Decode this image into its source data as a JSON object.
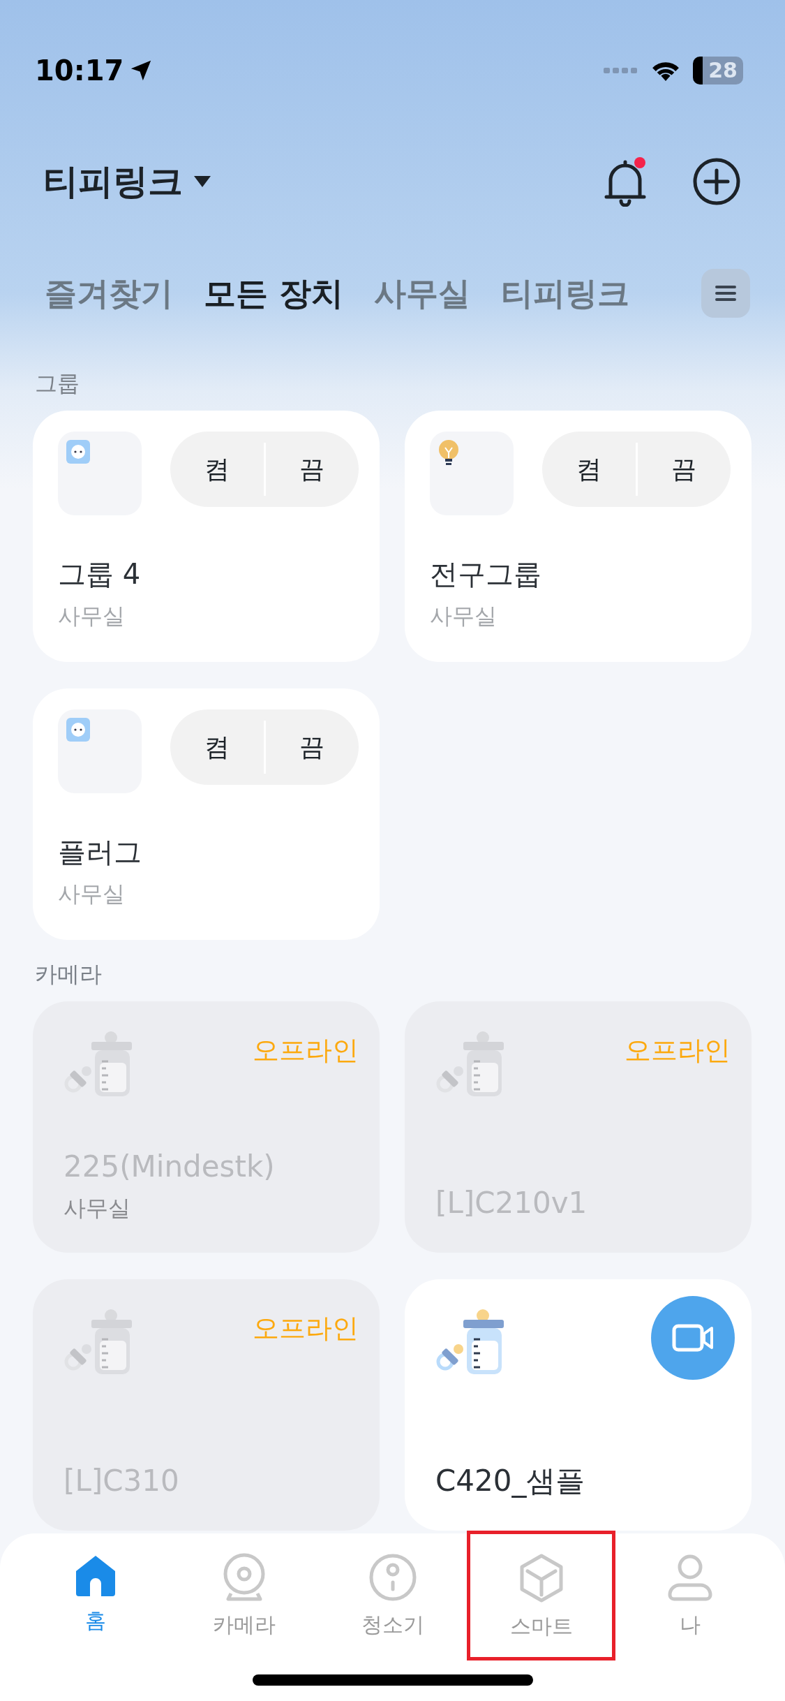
{
  "status_bar": {
    "time": "10:17",
    "battery": "28"
  },
  "header": {
    "title": "티피링크",
    "notification_unread": true
  },
  "tabs": [
    {
      "label": "즐겨찾기",
      "selected": false
    },
    {
      "label": "모든 장치",
      "selected": true
    },
    {
      "label": "사무실",
      "selected": false
    },
    {
      "label": "티피링크",
      "selected": false
    }
  ],
  "sections": [
    {
      "title": "그룹",
      "kind": "groups",
      "items": [
        {
          "name": "그룹 4",
          "room": "사무실",
          "kind": "plug",
          "on_label": "켬",
          "off_label": "끔"
        },
        {
          "name": "전구그룹",
          "room": "사무실",
          "kind": "bulb",
          "on_label": "켬",
          "off_label": "끔"
        },
        {
          "name": "플러그",
          "room": "사무실",
          "kind": "plug",
          "on_label": "켬",
          "off_label": "끔"
        }
      ]
    },
    {
      "title": "카메라",
      "kind": "cameras",
      "items": [
        {
          "name": "225(Mindestk)",
          "room": "사무실",
          "online": false,
          "status": "오프라인"
        },
        {
          "name": "[L]C210v1",
          "online": false,
          "status": "오프라인"
        },
        {
          "name": "[L]C310",
          "online": false,
          "status": "오프라인"
        },
        {
          "name": "C420_샘플",
          "online": true
        }
      ]
    }
  ],
  "bottom_nav": [
    {
      "label": "홈",
      "kind": "home",
      "selected": true,
      "highlighted": false
    },
    {
      "label": "카메라",
      "kind": "camera",
      "selected": false,
      "highlighted": false
    },
    {
      "label": "청소기",
      "kind": "vacuum",
      "selected": false,
      "highlighted": false
    },
    {
      "label": "스마트",
      "kind": "cube",
      "selected": false,
      "highlighted": true
    },
    {
      "label": "나",
      "kind": "person",
      "selected": false,
      "highlighted": false
    }
  ]
}
